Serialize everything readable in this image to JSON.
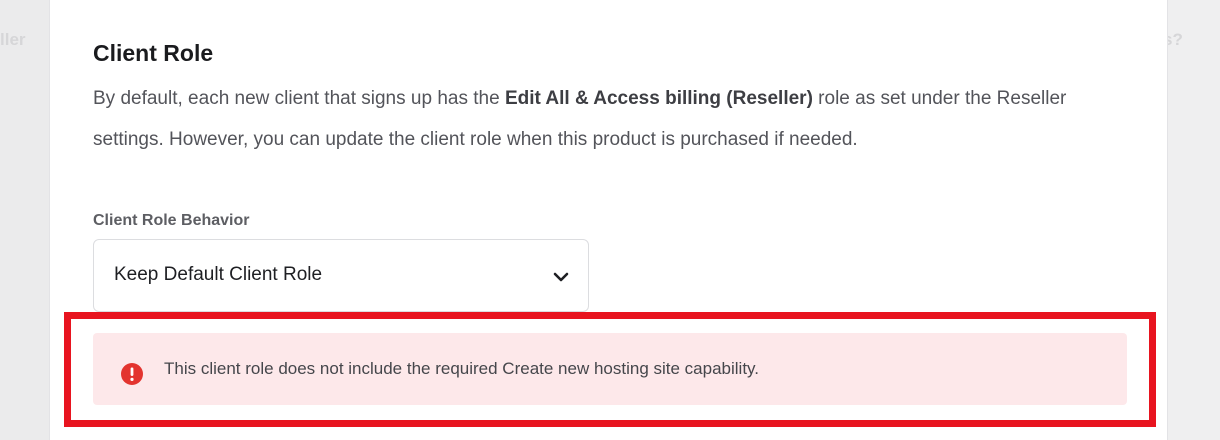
{
  "background": {
    "left_fragment": "ller",
    "right_fragment": "s?"
  },
  "section": {
    "title": "Client Role",
    "description_part1": "By default, each new client that signs up has the ",
    "description_bold": "Edit All & Access billing (Reseller)",
    "description_part2": " role as set under the Reseller settings. However, you can update the client role when this product is purchased if needed."
  },
  "behavior_field": {
    "label": "Client Role Behavior",
    "selected_value": "Keep Default Client Role",
    "icon": "chevron-down-icon"
  },
  "alert": {
    "icon": "info-icon",
    "message": "This client role does not include the required Create new hosting site capability.",
    "color": "#fde8ea",
    "icon_color": "#e3342f"
  },
  "highlight": {
    "color": "#e8141f"
  }
}
